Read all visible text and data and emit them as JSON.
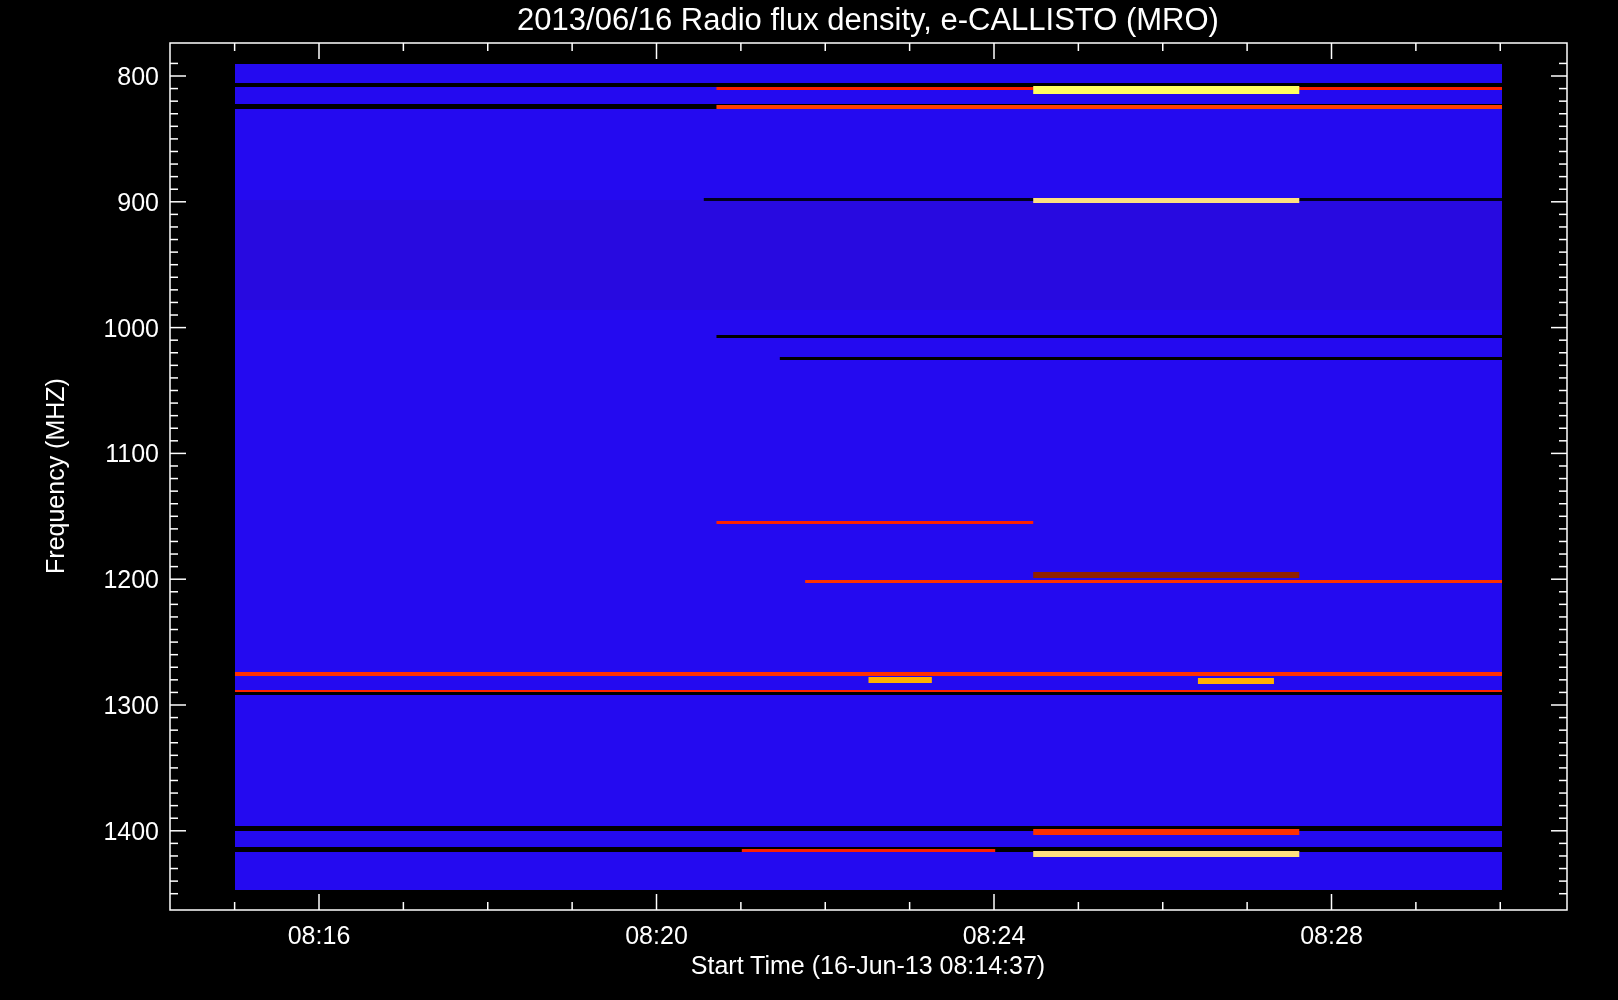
{
  "title": "2013/06/16  Radio flux density, e-CALLISTO (MRO)",
  "y_axis": {
    "label": "Frequency (MHZ)",
    "ticks": [
      "800",
      "900",
      "1000",
      "1100",
      "1200",
      "1300",
      "1400"
    ]
  },
  "x_axis": {
    "label": "Start Time (16-Jun-13 08:14:37)",
    "ticks": [
      "08:16",
      "08:20",
      "08:24",
      "08:28"
    ]
  }
}
